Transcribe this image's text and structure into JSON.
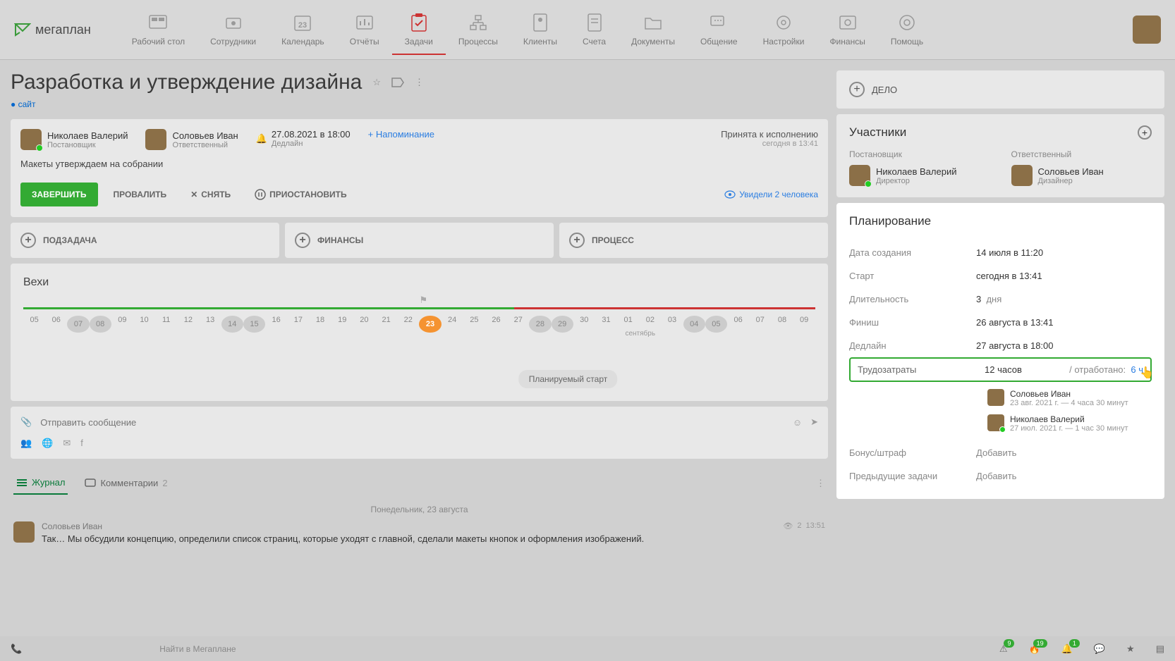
{
  "logo": "мегаплан",
  "nav": [
    {
      "label": "Рабочий стол"
    },
    {
      "label": "Сотрудники"
    },
    {
      "label": "Календарь",
      "badge": "23"
    },
    {
      "label": "Отчёты"
    },
    {
      "label": "Задачи"
    },
    {
      "label": "Процессы"
    },
    {
      "label": "Клиенты"
    },
    {
      "label": "Счета"
    },
    {
      "label": "Документы"
    },
    {
      "label": "Общение"
    },
    {
      "label": "Настройки"
    },
    {
      "label": "Финансы"
    },
    {
      "label": "Помощь"
    }
  ],
  "page": {
    "title": "Разработка и утверждение дизайна",
    "tag": "сайт"
  },
  "task": {
    "creator": {
      "name": "Николаев Валерий",
      "role": "Постановщик"
    },
    "assignee": {
      "name": "Соловьев Иван",
      "role": "Ответственный"
    },
    "deadline": {
      "date": "27.08.2021 в 18:00",
      "label": "Дедлайн"
    },
    "reminder": "+ Напоминание",
    "status": {
      "text": "Принята к исполнению",
      "time": "сегодня в 13:41"
    },
    "note": "Макеты утверждаем на собрании"
  },
  "actions": {
    "finish": "ЗАВЕРШИТЬ",
    "fail": "ПРОВАЛИТЬ",
    "cancel": "СНЯТЬ",
    "pause": "ПРИОСТАНОВИТЬ",
    "seen": "Увидели 2 человека"
  },
  "subButtons": {
    "subtask": "ПОДЗАДАЧА",
    "finance": "ФИНАНСЫ",
    "process": "ПРОЦЕСС"
  },
  "milestones": {
    "title": "Вехи",
    "dates": [
      "05",
      "06",
      "07",
      "08",
      "09",
      "10",
      "11",
      "12",
      "13",
      "14",
      "15",
      "16",
      "17",
      "18",
      "19",
      "20",
      "21",
      "22",
      "23",
      "24",
      "25",
      "26",
      "27",
      "28",
      "29",
      "30",
      "31",
      "01",
      "02",
      "03",
      "04",
      "05",
      "06",
      "07",
      "08",
      "09"
    ],
    "monthLabel": "сентябрь",
    "plannedStart": "Планируемый старт"
  },
  "message": {
    "placeholder": "Отправить сообщение"
  },
  "tabs": {
    "journal": "Журнал",
    "comments": "Комментарии",
    "commentsCount": "2"
  },
  "journal": {
    "date": "Понедельник, 23 августа",
    "author": "Соловьев Иван",
    "text": "Так… Мы обсудили концепцию, определили список страниц, которые уходят с главной, сделали макеты кнопок и оформления изображений.",
    "views": "2",
    "time": "13:51"
  },
  "sidebar": {
    "delo": "ДЕЛО",
    "participants": {
      "title": "Участники",
      "creator": {
        "role": "Постановщик",
        "name": "Николаев Валерий",
        "title": "Директор"
      },
      "assignee": {
        "role": "Ответственный",
        "name": "Соловьев Иван",
        "title": "Дизайнер"
      }
    },
    "planning": {
      "title": "Планирование",
      "created": {
        "label": "Дата создания",
        "value": "14 июля в 11:20"
      },
      "start": {
        "label": "Старт",
        "value": "сегодня в 13:41"
      },
      "duration": {
        "label": "Длительность",
        "value": "3",
        "unit": "дня"
      },
      "finish": {
        "label": "Финиш",
        "value": "26 августа в 13:41"
      },
      "deadline": {
        "label": "Дедлайн",
        "value": "27 августа в 18:00"
      },
      "effort": {
        "label": "Трудозатраты",
        "value": "12 часов",
        "workedLabel": "/ отработано:",
        "worked": "6 ч",
        "people": [
          {
            "name": "Соловьев Иван",
            "detail": "23 авг. 2021 г. — 4 часа 30 минут"
          },
          {
            "name": "Николаев Валерий",
            "detail": "27 июл. 2021 г. — 1 час 30 минут"
          }
        ]
      },
      "bonus": {
        "label": "Бонус/штраф",
        "value": "Добавить"
      },
      "prevTasks": {
        "label": "Предыдущие задачи",
        "value": "Добавить"
      }
    }
  },
  "bottombar": {
    "search": "Найти в Мегаплане",
    "badges": {
      "alert": "9",
      "fire": "19",
      "bell": "1"
    }
  }
}
